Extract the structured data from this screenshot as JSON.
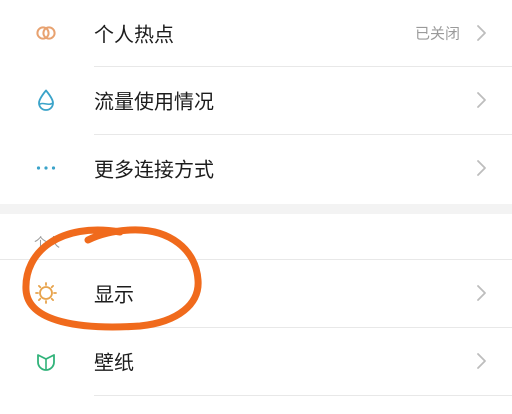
{
  "settings": {
    "rows": [
      {
        "label": "个人热点",
        "value": "已关闭",
        "icon": "hotspot-icon"
      },
      {
        "label": "流量使用情况",
        "icon": "data-usage-icon"
      },
      {
        "label": "更多连接方式",
        "icon": "more-connections-icon"
      }
    ],
    "section_title": "个人",
    "personal_rows": [
      {
        "label": "显示",
        "icon": "display-icon"
      },
      {
        "label": "壁纸",
        "icon": "wallpaper-icon"
      }
    ]
  },
  "colors": {
    "hotspot_icon": "#e8a270",
    "data_icon": "#3aa3c9",
    "more_icon": "#3aa3c9",
    "display_icon": "#e7a34c",
    "wallpaper_icon": "#31b37a",
    "annotation_stroke": "#f06a1c"
  }
}
